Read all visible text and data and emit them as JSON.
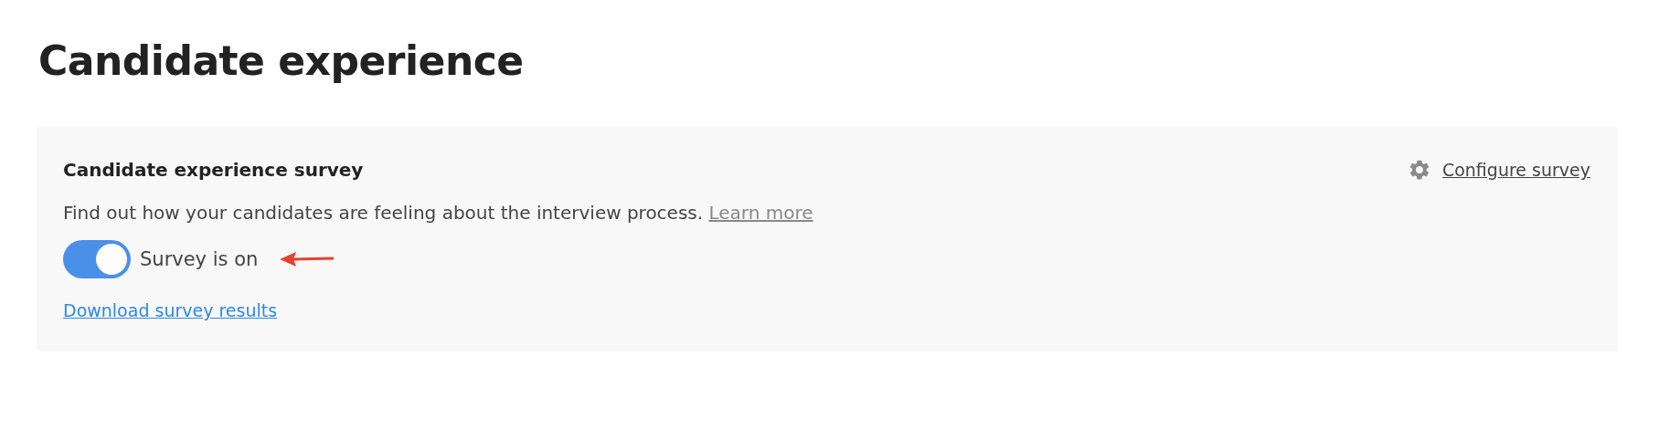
{
  "page_title": "Candidate experience",
  "card": {
    "title": "Candidate experience survey",
    "configure_link": "Configure survey",
    "description": "Find out how your candidates are feeling about the interview process.",
    "learn_more_link": "Learn more",
    "toggle": {
      "label": "Survey is on",
      "on": true
    },
    "download_link": "Download survey results"
  }
}
